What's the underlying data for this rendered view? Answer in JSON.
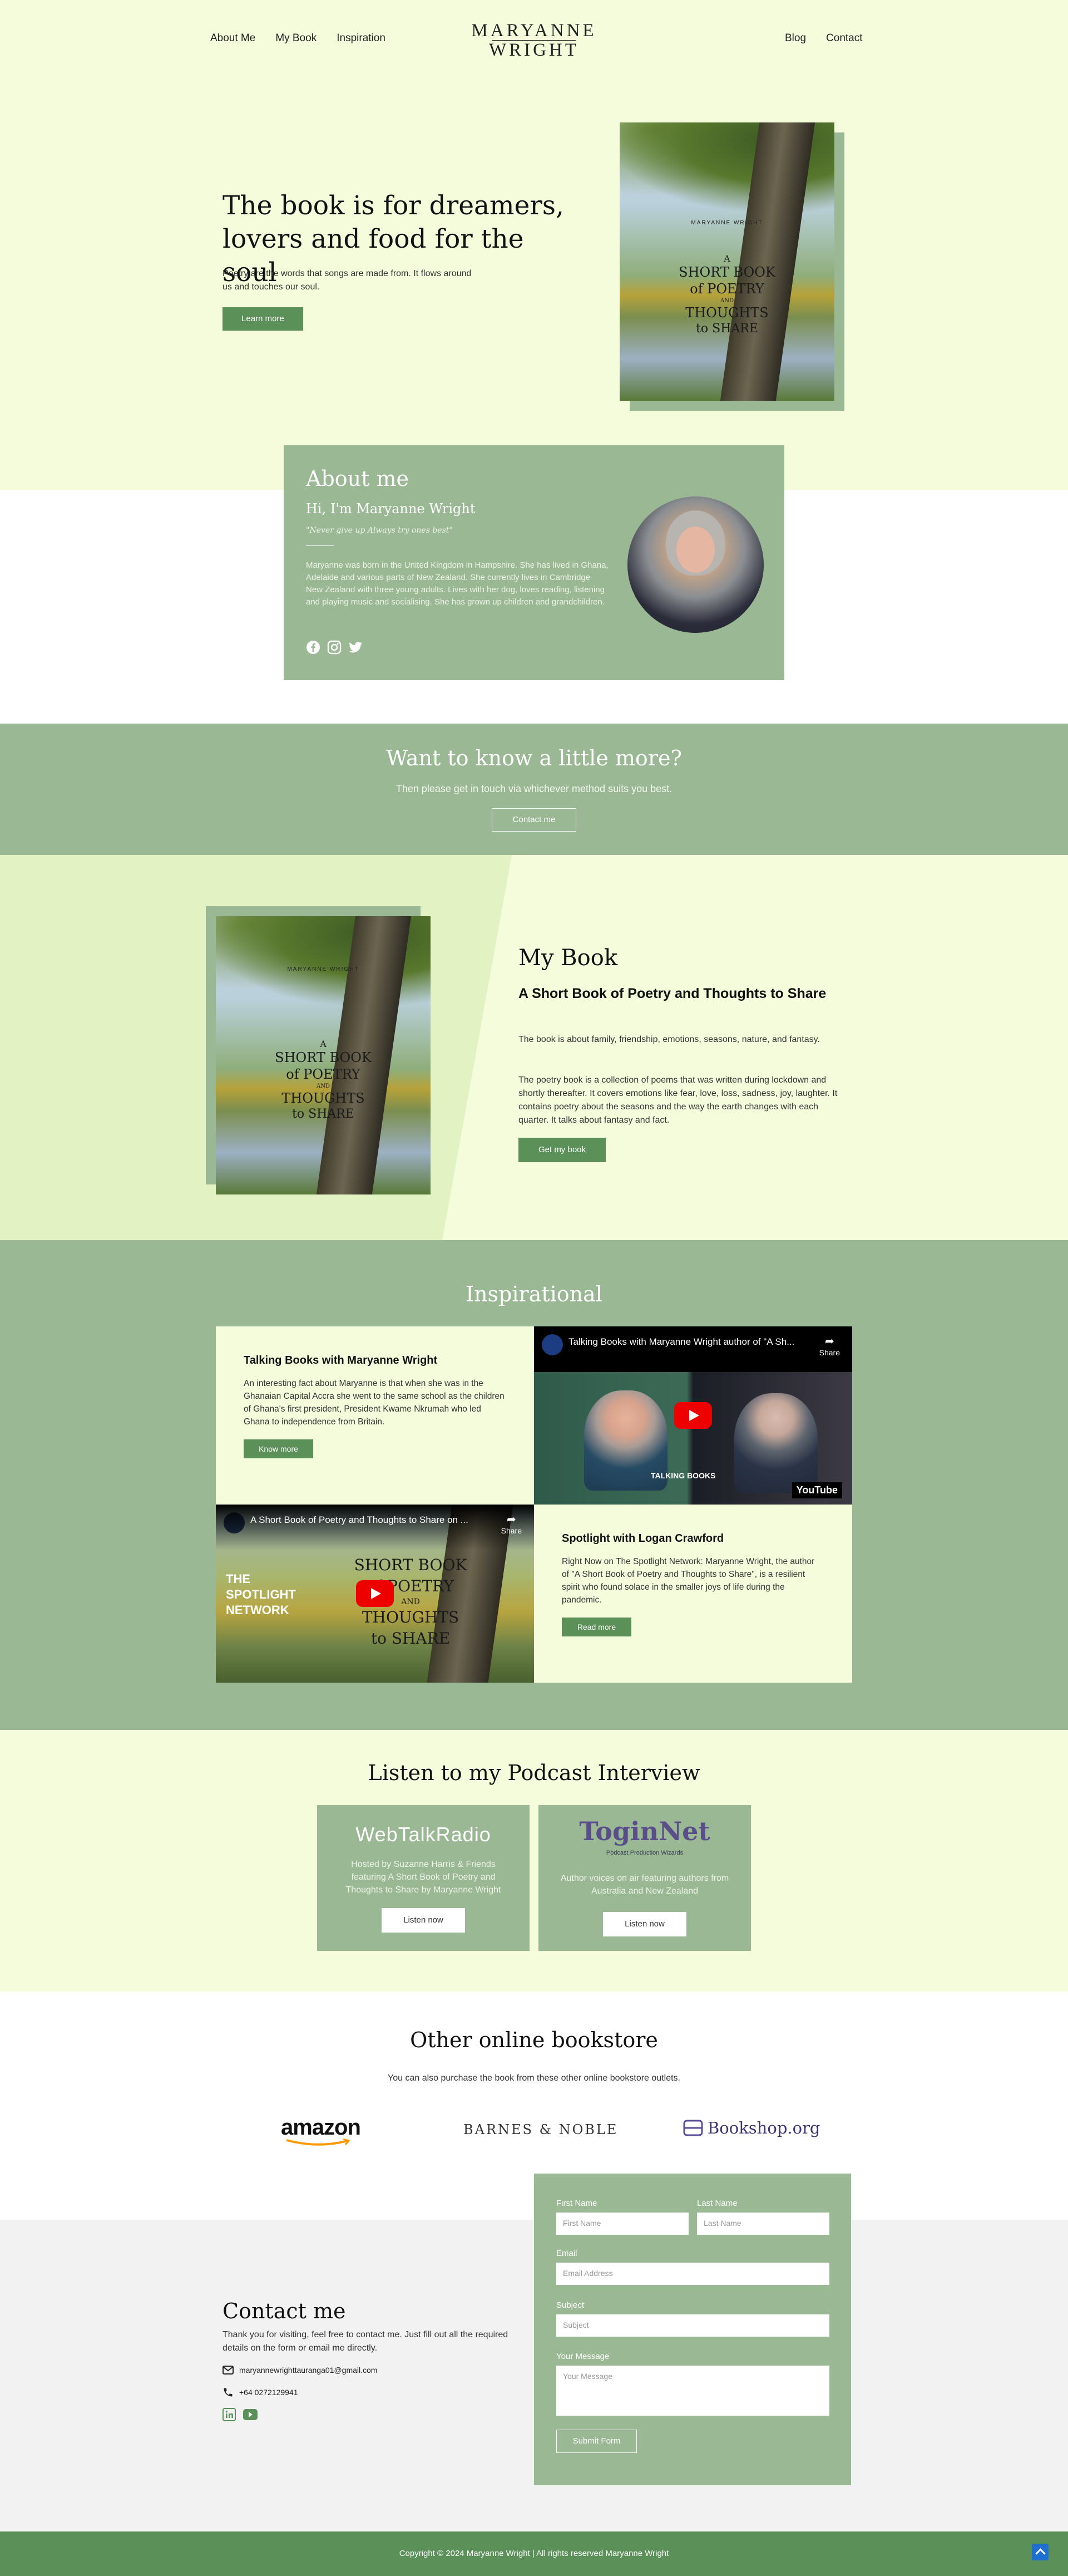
{
  "header": {
    "nav_left": [
      "About Me",
      "My Book",
      "Inspiration"
    ],
    "logo_line1": "MARYANNE",
    "logo_line2": "WRIGHT",
    "nav_right": [
      "Blog",
      "Contact"
    ]
  },
  "hero": {
    "title": "The book is for dreamers, lovers and food for the soul",
    "text": "Poetry are the words that songs are made from. It flows around us and touches our soul.",
    "button": "Learn more"
  },
  "book_cover": {
    "author": "MARYANNE WRIGHT",
    "title_lines": [
      "A",
      "SHORT BOOK",
      "of POETRY",
      "AND",
      "THOUGHTS",
      "to SHARE"
    ]
  },
  "about": {
    "heading": "About me",
    "subheading": "Hi, I'm Maryanne Wright",
    "quote": "\"Never give up Always try ones best\"",
    "text": "Maryanne was born in the United Kingdom in Hampshire. She has lived in Ghana, Adelaide and various parts of New Zealand. She currently lives in Cambridge New Zealand with three young adults. Lives with her dog, loves reading, listening and playing music and socialising. She has grown up children and grandchildren.",
    "social": [
      "facebook-icon",
      "instagram-icon",
      "twitter-icon"
    ]
  },
  "contact_band": {
    "title": "Want to know a little more?",
    "text": "Then please get in touch via whichever method suits you best.",
    "button": "Contact me"
  },
  "my_book": {
    "title": "My Book",
    "subtitle": "A Short Book of Poetry and Thoughts to Share",
    "p1": "The book is about family, friendship, emotions, seasons, nature, and fantasy.",
    "p2": "The poetry book is a collection of poems that was written during lockdown and shortly thereafter. It covers emotions like fear, love, loss, sadness, joy, laughter. It contains poetry about the seasons and the way the earth changes with each quarter. It talks about fantasy and fact.",
    "button": "Get my book"
  },
  "inspirational": {
    "title": "Inspirational",
    "card1": {
      "title": "Talking Books with Maryanne Wright",
      "text": "An interesting fact about Maryanne is that when she was in the Ghanaian Capital Accra she went to the same school as the children of Ghana's first president, President Kwame Nkrumah who led Ghana to independence from Britain.",
      "button": "Know more"
    },
    "video1": {
      "title": "Talking Books with Maryanne Wright author of \"A Sh...",
      "share": "Share",
      "badge": "TALKING BOOKS",
      "youtube": "YouTube"
    },
    "video2": {
      "title": "A Short Book of Poetry and Thoughts to Share on ...",
      "overlay": "THE SPOTLIGHT NETWORK",
      "share": "Share"
    },
    "card2": {
      "title": "Spotlight with Logan Crawford",
      "text": "Right Now on The Spotlight Network: Maryanne Wright, the author of \"A Short Book of Poetry and Thoughts to Share\", is a resilient spirit who found solace in the smaller joys of life during the pandemic.",
      "button": "Read more"
    }
  },
  "podcast": {
    "title": "Listen to my Podcast Interview",
    "items": [
      {
        "logo": "WebTalkRadio",
        "desc": "Hosted by Suzanne Harris & Friends featuring A Short Book of Poetry and Thoughts to Share by Maryanne Wright",
        "button": "Listen now"
      },
      {
        "logo": "ToginNet",
        "logo_sub": "Podcast Production Wizards",
        "desc": "Author voices on air featuring authors from Australia and New Zealand",
        "button": "Listen now"
      }
    ]
  },
  "stores": {
    "title": "Other online bookstore",
    "text": "You can also purchase the book from these other online bookstore outlets.",
    "items": [
      "amazon",
      "BARNES & NOBLE",
      "Bookshop.org"
    ]
  },
  "contact": {
    "title": "Contact me",
    "text": "Thank you for visiting, feel free to contact me. Just fill out all the required details on the form or email me directly.",
    "email": "maryannewrighttauranga01@gmail.com",
    "phone": "+64 0272129941",
    "form": {
      "first_name_label": "First Name",
      "first_name_placeholder": "First Name",
      "last_name_label": "Last Name",
      "last_name_placeholder": "Last Name",
      "email_label": "Email",
      "email_placeholder": "Email Address",
      "subject_label": "Subject",
      "subject_placeholder": "Subject",
      "message_label": "Your Message",
      "message_placeholder": "Your Message",
      "submit": "Submit Form"
    }
  },
  "footer": {
    "copyright": "Copyright © 2024 Maryanne Wright | All rights reserved Maryanne Wright"
  },
  "colors": {
    "light_bg": "#f4fcdc",
    "sage": "#9ab893",
    "button_green": "#5b9058",
    "footer_green": "#5b9058"
  }
}
